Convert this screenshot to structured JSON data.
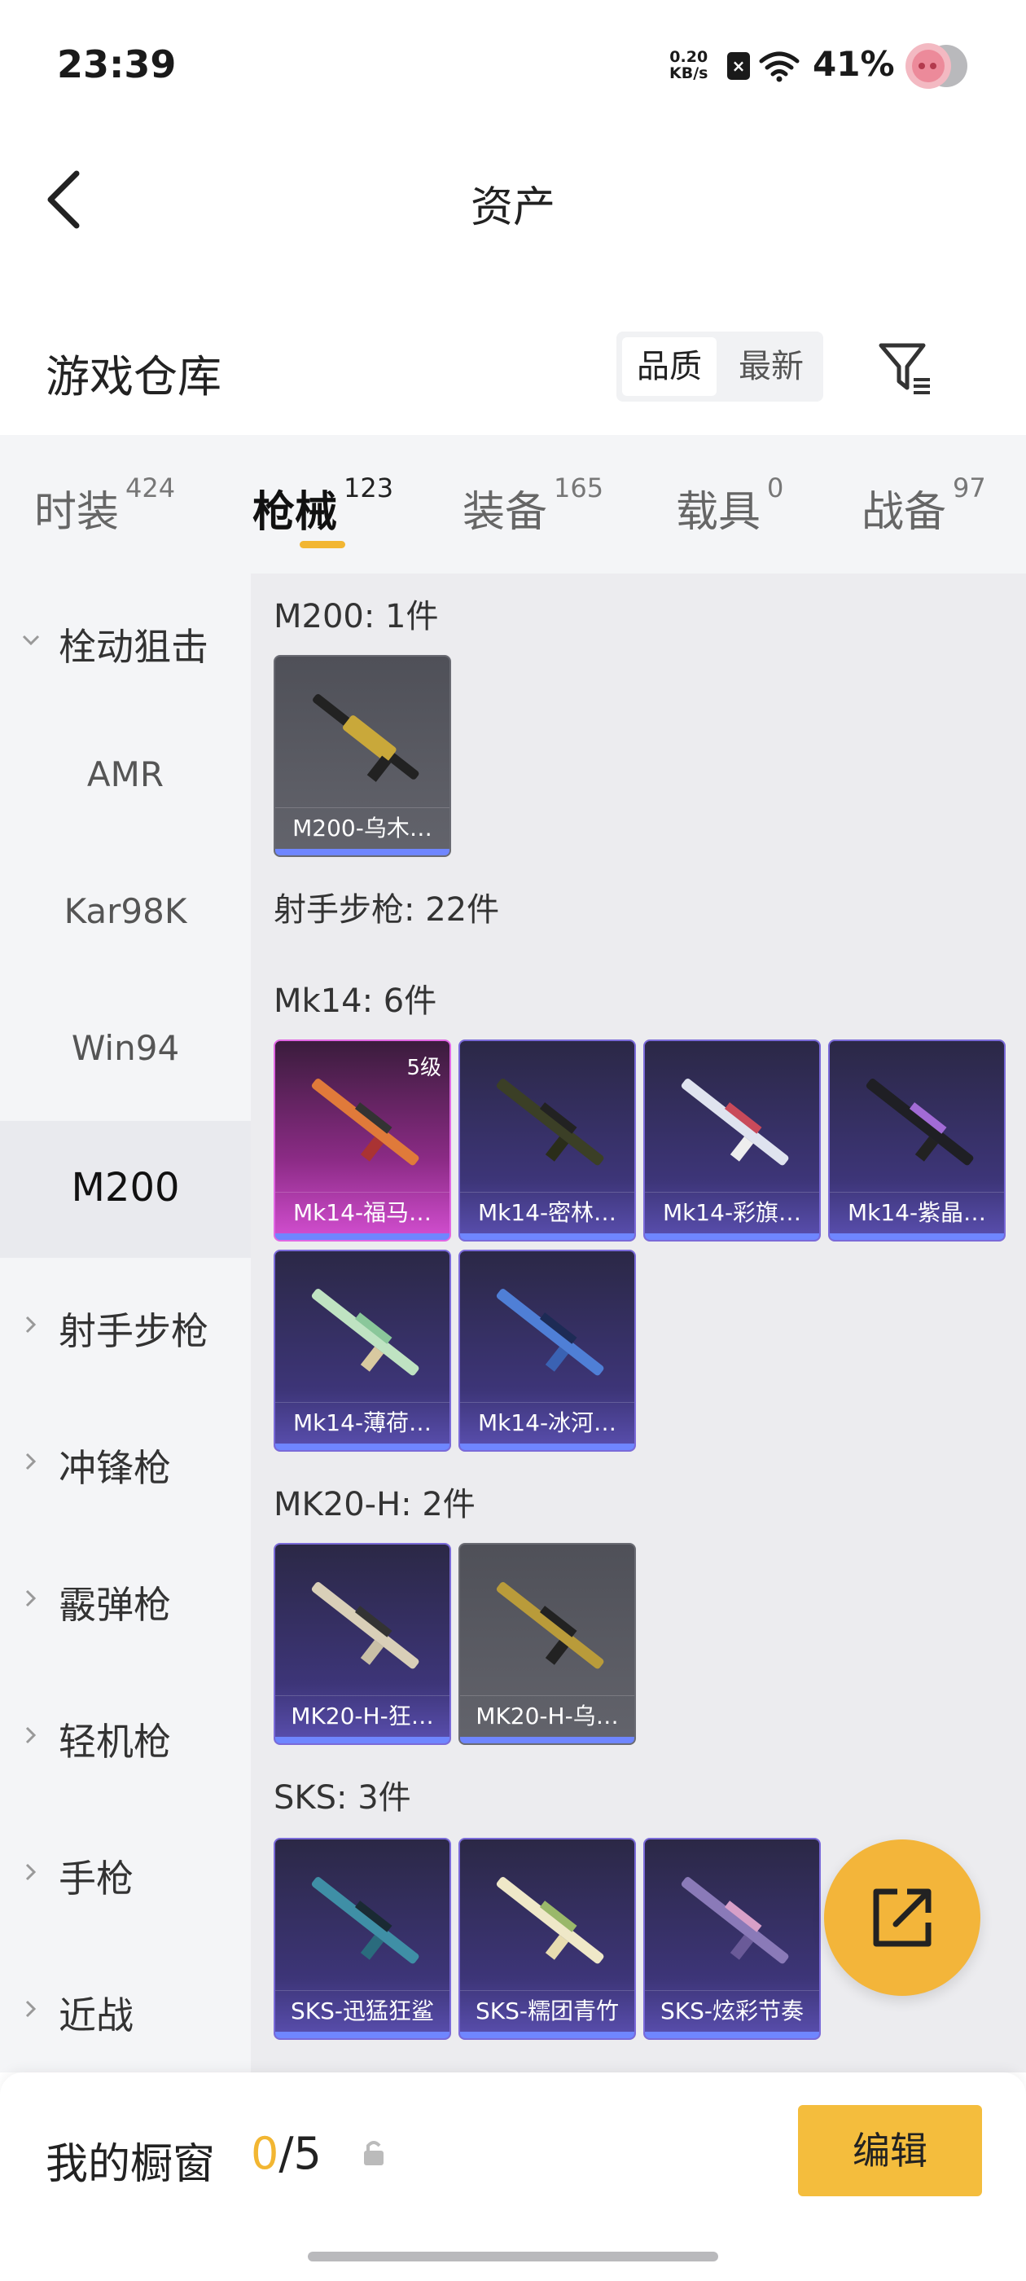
{
  "status": {
    "time": "23:39",
    "speed_top": "0.20",
    "speed_bottom": "KB/s",
    "battery": "41%"
  },
  "header": {
    "title": "资产"
  },
  "warehouse": {
    "title": "游戏仓库",
    "sort_quality": "品质",
    "sort_latest": "最新"
  },
  "tabs": [
    {
      "label": "时装",
      "count": "424"
    },
    {
      "label": "枪械",
      "count": "123"
    },
    {
      "label": "装备",
      "count": "165"
    },
    {
      "label": "载具",
      "count": "0"
    },
    {
      "label": "战备",
      "count": "97"
    }
  ],
  "sidebar": {
    "group_bolt": "栓动狙击",
    "sub_items": [
      "AMR",
      "Kar98K",
      "Win94",
      "M200"
    ],
    "groups": [
      "射手步枪",
      "冲锋枪",
      "霰弹枪",
      "轻机枪",
      "手枪",
      "近战"
    ]
  },
  "sections": {
    "m200": "M200: 1件",
    "dmr": "射手步枪: 22件",
    "mk14": "Mk14: 6件",
    "mk20": "MK20-H: 2件",
    "sks": "SKS: 3件"
  },
  "items": {
    "m200_1": "M200-乌木…",
    "mk14_1": "Mk14-福马…",
    "mk14_1_level": "5级",
    "mk14_2": "Mk14-密林…",
    "mk14_3": "Mk14-彩旗…",
    "mk14_4": "Mk14-紫晶…",
    "mk14_5": "Mk14-薄荷…",
    "mk14_6": "Mk14-冰河…",
    "mk20_1": "MK20-H-狂…",
    "mk20_2": "MK20-H-乌…",
    "sks_1": "SKS-迅猛狂鲨",
    "sks_2": "SKS-糯团青竹",
    "sks_3": "SKS-炫彩节奏"
  },
  "showcase": {
    "title": "我的橱窗",
    "count_used": "0",
    "count_total": "/5",
    "edit_label": "编辑"
  },
  "colors": {
    "accent": "#f2b632",
    "card_purple": "#3d3578",
    "card_pink": "#8c2b86",
    "card_grey": "#5a5b63"
  }
}
